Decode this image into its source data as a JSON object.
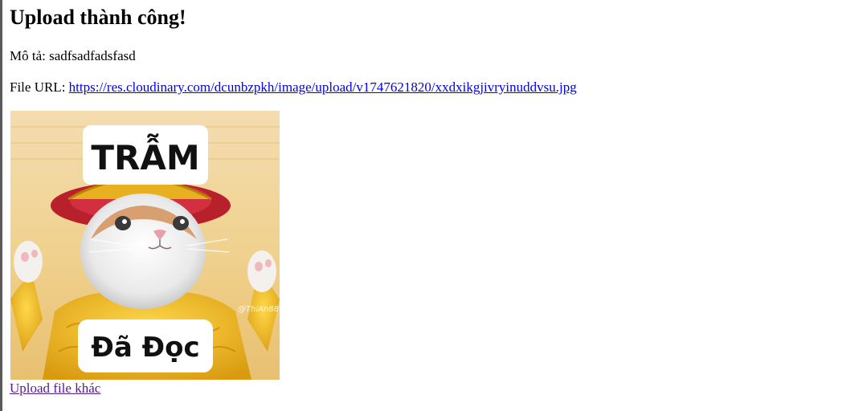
{
  "page": {
    "heading": "Upload thành công!",
    "description_label": "Mô tả:",
    "description_value": "sadfsadfadsfasd",
    "file_url_label": "File URL:",
    "file_url": "https://res.cloudinary.com/dcunbzpkh/image/upload/v1747621820/xxdxikgjivryinuddvsu.jpg",
    "upload_again_label": "Upload file khác"
  },
  "image": {
    "top_caption": "TRẪM",
    "bottom_caption": "Đã Đọc",
    "watermark": "@ThiAn88"
  },
  "colors": {
    "link": "#0000ee",
    "visited_link": "#551a8b"
  }
}
